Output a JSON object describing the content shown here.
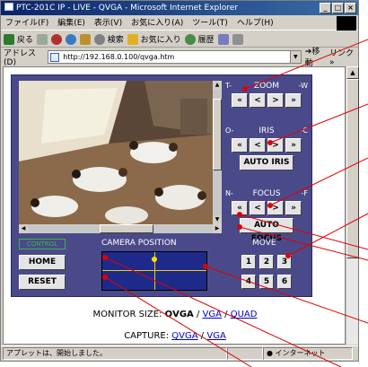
{
  "window": {
    "title": "PTC-201C IP - LIVE - QVGA - Microsoft Internet Explorer",
    "buttons": [
      "_",
      "□",
      "×"
    ]
  },
  "menu": [
    "ファイル(F)",
    "編集(E)",
    "表示(V)",
    "お気に入り(A)",
    "ツール(T)",
    "ヘルプ(H)"
  ],
  "toolbar": {
    "back": "戻る",
    "search": "検索",
    "favorites": "お気に入り",
    "history": "履歴"
  },
  "address": {
    "label": "アドレス(D)",
    "url": "http://192.168.0.100/qvga.htm",
    "go": "移動",
    "links": "リンク »"
  },
  "zoom": {
    "title": "ZOOM",
    "neg": "T-",
    "pos": "-W",
    "buttons": [
      "«",
      "<",
      ">",
      "»"
    ]
  },
  "iris": {
    "title": "IRIS",
    "neg": "O-",
    "pos": "-C",
    "buttons": [
      "«",
      "<",
      ">",
      "»"
    ],
    "auto": "AUTO IRIS"
  },
  "focus": {
    "title": "FOCUS",
    "neg": "N-",
    "pos": "-F",
    "buttons": [
      "«",
      "<",
      ">",
      "»"
    ],
    "auto": "AUTO FOCUS"
  },
  "control": {
    "badge": "CONTROL",
    "camera_position": "CAMERA POSITION",
    "move": "MOVE",
    "home": "HOME",
    "reset": "RESET",
    "move_buttons": [
      "1",
      "2",
      "3",
      "4",
      "5",
      "6"
    ]
  },
  "monitor": {
    "label": "MONITOR SIZE:",
    "current": "QVGA",
    "sep": "/",
    "vga": "VGA",
    "quad": "QUAD"
  },
  "capture": {
    "label": "CAPTURE:",
    "qvga": "QVGA",
    "sep": "/",
    "vga": "VGA"
  },
  "status": {
    "message": "アプレットは、開始しました。",
    "zone": "インターネット"
  },
  "colors": {
    "panel": "#4a4a8a",
    "map": "#1e2a8a",
    "marker": "#ffe000",
    "callout": "#e00000",
    "link": "#0000cc"
  }
}
